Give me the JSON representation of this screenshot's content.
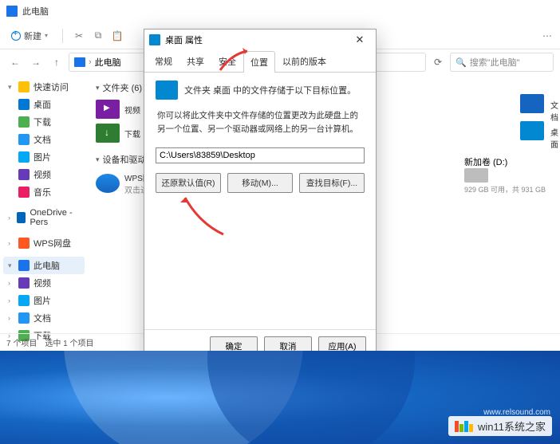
{
  "window": {
    "title": "此电脑"
  },
  "toolbar": {
    "new": "新建"
  },
  "breadcrumb": {
    "root": "此电脑"
  },
  "search": {
    "placeholder": "搜索\"此电脑\""
  },
  "sidebar": {
    "items": [
      {
        "label": "快速访问"
      },
      {
        "label": "桌面"
      },
      {
        "label": "下载"
      },
      {
        "label": "文档"
      },
      {
        "label": "图片"
      },
      {
        "label": "视频"
      },
      {
        "label": "音乐"
      },
      {
        "label": "OneDrive - Pers"
      },
      {
        "label": "WPS网盘"
      },
      {
        "label": "此电脑"
      },
      {
        "label": "视频"
      },
      {
        "label": "图片"
      },
      {
        "label": "文档"
      },
      {
        "label": "下载"
      }
    ]
  },
  "sections": {
    "folders": "文件夹 (6)",
    "devices": "设备和驱动器",
    "devices_hint": "双击进"
  },
  "folders": {
    "video": "视频",
    "download": "下载",
    "wps": "WPS网",
    "docs": "文档",
    "desktop": "桌面"
  },
  "drive": {
    "name": "新加卷 (D:)",
    "info": "929 GB 可用，共 931 GB"
  },
  "status": {
    "count": "7 个项目",
    "selected": "选中 1 个项目"
  },
  "dialog": {
    "title": "桌面 属性",
    "tabs": {
      "general": "常规",
      "share": "共享",
      "security": "安全",
      "location": "位置",
      "previous": "以前的版本"
    },
    "desc": "文件夹 桌面 中的文件存储于以下目标位置。",
    "hint": "你可以将此文件夹中文件存储的位置更改为此硬盘上的另一个位置、另一个驱动器或网络上的另一台计算机。",
    "path": "C:\\Users\\83859\\Desktop",
    "buttons": {
      "restore": "还原默认值(R)",
      "move": "移动(M)...",
      "find": "查找目标(F)..."
    },
    "footer": {
      "ok": "确定",
      "cancel": "取消",
      "apply": "应用(A)"
    }
  },
  "watermark": {
    "text": "win11系统之家",
    "url": "www.relsound.com"
  }
}
